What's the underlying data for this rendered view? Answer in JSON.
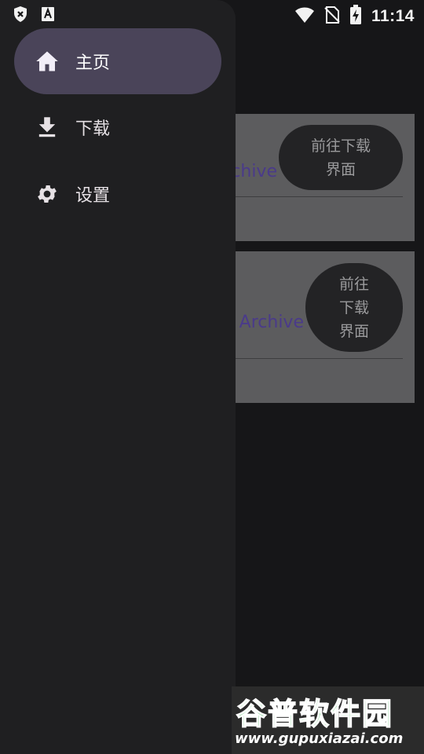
{
  "status_bar": {
    "time": "11:14",
    "icons": [
      "shield-x-icon",
      "text-a-icon",
      "wifi-icon",
      "no-sim-icon",
      "battery-charging-icon"
    ]
  },
  "drawer": {
    "items": [
      {
        "label": "主页",
        "icon": "home-icon",
        "active": true
      },
      {
        "label": "下载",
        "icon": "download-icon",
        "active": false
      },
      {
        "label": "设置",
        "icon": "gear-icon",
        "active": false
      }
    ]
  },
  "cards": [
    {
      "title": "chive",
      "button_lines": [
        "前往下载",
        "界面"
      ]
    },
    {
      "title": "Archive",
      "button_lines": [
        "前往",
        "下载",
        "界面"
      ]
    }
  ],
  "watermark": {
    "title": "谷普软件园",
    "url": "www.gupuxiazai.com"
  },
  "colors": {
    "background": "#161618",
    "drawer": "#1f1f21",
    "active_item": "#4a4459",
    "card": "#5c5c5e",
    "card_title": "#4a3a8a",
    "watermark_green": "#35b44a"
  }
}
